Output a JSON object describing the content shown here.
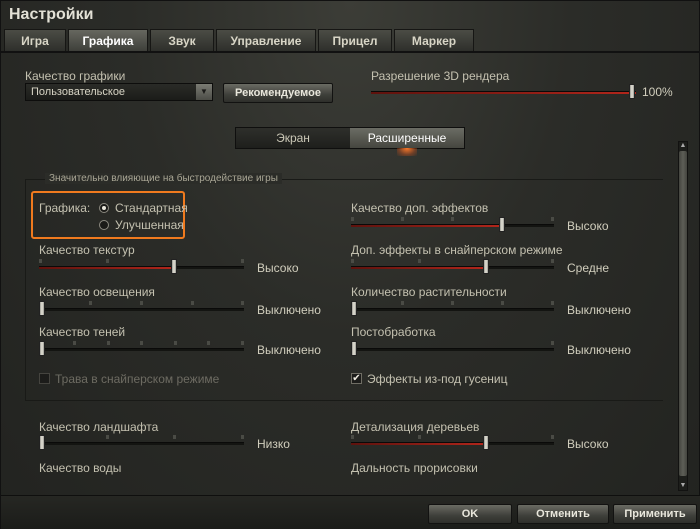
{
  "window": {
    "title": "Настройки"
  },
  "tabs": [
    {
      "label": "Игра"
    },
    {
      "label": "Графика"
    },
    {
      "label": "Звук"
    },
    {
      "label": "Управление"
    },
    {
      "label": "Прицел"
    },
    {
      "label": "Маркер"
    }
  ],
  "quality": {
    "label": "Качество графики",
    "selected": "Пользовательское",
    "recommended_button": "Рекомендуемое"
  },
  "resolution3d": {
    "label": "Разрешение 3D рендера",
    "value_text": "100%",
    "level": 1.0
  },
  "subtabs": [
    {
      "label": "Экран"
    },
    {
      "label": "Расширенные"
    }
  ],
  "panel_title": "Значительно влияющие на быстродействие игры",
  "graphics_mode": {
    "label": "Графика:",
    "options": [
      {
        "label": "Стандартная",
        "selected": true
      },
      {
        "label": "Улучшенная",
        "selected": false
      }
    ]
  },
  "left_sliders": [
    {
      "label": "Качество текстур",
      "value": "Высоко",
      "level": 0.67
    },
    {
      "label": "Качество освещения",
      "value": "Выключено",
      "level": 0.0
    },
    {
      "label": "Качество теней",
      "value": "Выключено",
      "level": 0.0
    }
  ],
  "right_sliders": [
    {
      "label": "Качество доп. эффектов",
      "value": "Высоко",
      "level": 0.75
    },
    {
      "label": "Доп. эффекты в снайперском режиме",
      "value": "Средне",
      "level": 0.67
    },
    {
      "label": "Количество растительности",
      "value": "Выключено",
      "level": 0.0
    },
    {
      "label": "Постобработка",
      "value": "Выключено",
      "level": 0.0
    }
  ],
  "checkboxes": {
    "sniper_grass": {
      "label": "Трава в снайперском режиме",
      "checked": false,
      "enabled": false
    },
    "track_effects": {
      "label": "Эффекты из-под гусениц",
      "checked": true,
      "enabled": true
    }
  },
  "lower_sliders": {
    "landscape": {
      "label": "Качество ландшафта",
      "value": "Низко",
      "level": 0.0
    },
    "trees": {
      "label": "Детализация деревьев",
      "value": "Высоко",
      "level": 0.67
    },
    "water": {
      "label": "Качество воды"
    },
    "draw_distance": {
      "label": "Дальность прорисовки"
    }
  },
  "buttons": {
    "ok": "OK",
    "cancel": "Отменить",
    "apply": "Применить"
  },
  "colors": {
    "accent": "#f07a1e",
    "slider_fill": "#b3261b"
  }
}
